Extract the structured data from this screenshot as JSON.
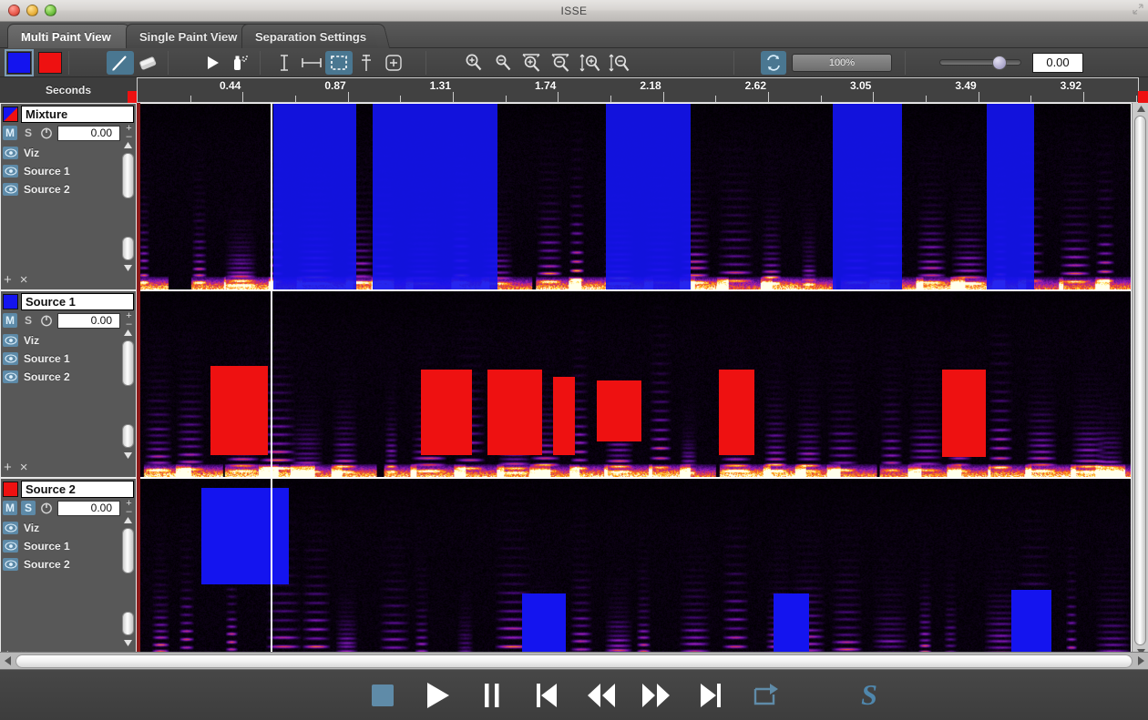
{
  "window": {
    "title": "ISSE",
    "controls": [
      "close",
      "minimize",
      "zoom"
    ]
  },
  "tabs": [
    {
      "label": "Multi Paint View",
      "active": true
    },
    {
      "label": "Single Paint View",
      "active": false
    },
    {
      "label": "Separation Settings",
      "active": false
    }
  ],
  "toolbar": {
    "swatches": [
      {
        "name": "paint-color-blue",
        "color": "#1414ef",
        "selected": true
      },
      {
        "name": "paint-color-red",
        "color": "#ee1111",
        "selected": false
      }
    ],
    "tools": [
      {
        "name": "brush-tool",
        "icon": "brush-icon",
        "active": true
      },
      {
        "name": "eraser-tool",
        "icon": "eraser-icon",
        "active": false
      },
      {
        "name": "pointer-tool",
        "icon": "pointer-icon",
        "active": false
      },
      {
        "name": "spray-tool",
        "icon": "spray-icon",
        "active": false
      },
      {
        "name": "time-select-tool",
        "icon": "i-beam-icon",
        "active": false
      },
      {
        "name": "time-range-tool",
        "icon": "horizontal-range-icon",
        "active": false
      },
      {
        "name": "box-select-tool",
        "icon": "marquee-icon",
        "active": true
      },
      {
        "name": "freq-range-tool",
        "icon": "vertical-range-icon",
        "active": false
      },
      {
        "name": "add-tool",
        "icon": "plus-circle-icon",
        "active": false
      }
    ],
    "zoom_tools": [
      {
        "name": "zoom-in-button",
        "icon": "magnifier-plus-icon"
      },
      {
        "name": "zoom-out-button",
        "icon": "magnifier-minus-icon"
      },
      {
        "name": "zoom-in-horizontal-button",
        "icon": "magnifier-horizontal-plus-icon"
      },
      {
        "name": "zoom-out-horizontal-button",
        "icon": "magnifier-horizontal-minus-icon"
      },
      {
        "name": "zoom-in-vertical-button",
        "icon": "magnifier-vertical-plus-icon"
      },
      {
        "name": "zoom-out-vertical-button",
        "icon": "magnifier-vertical-minus-icon"
      }
    ],
    "loop_button": {
      "name": "loop-toggle",
      "icon": "loop-icon",
      "active": true
    },
    "zoom_percent": "100%",
    "slider_value": "0.00",
    "slider_position_pct": 66
  },
  "ruler": {
    "unit_label": "Seconds",
    "ticks": [
      "0.44",
      "0.87",
      "1.31",
      "1.74",
      "2.18",
      "2.62",
      "3.05",
      "3.49",
      "3.92"
    ]
  },
  "tracks": [
    {
      "name": "Mixture",
      "color": "#1414ef",
      "swatch_kind": "split",
      "mute": "M",
      "solo": "S",
      "mute_on": true,
      "solo_on": false,
      "time_value": "0.00",
      "layers": [
        "Viz",
        "Source 1",
        "Source 2"
      ],
      "add_label": "+",
      "remove_label": "×"
    },
    {
      "name": "Source 1",
      "color": "#1414ef",
      "swatch_kind": "solid",
      "mute": "M",
      "solo": "S",
      "mute_on": true,
      "solo_on": false,
      "time_value": "0.00",
      "layers": [
        "Viz",
        "Source 1",
        "Source 2"
      ],
      "add_label": "+",
      "remove_label": "×"
    },
    {
      "name": "Source 2",
      "color": "#ee1111",
      "swatch_kind": "solid",
      "mute": "M",
      "solo": "S",
      "mute_on": true,
      "solo_on": true,
      "time_value": "0.00",
      "layers": [
        "Viz",
        "Source 1",
        "Source 2"
      ],
      "add_label": "+",
      "remove_label": "×"
    }
  ],
  "transport": [
    {
      "name": "stop-button",
      "icon": "stop-icon"
    },
    {
      "name": "play-button",
      "icon": "play-icon"
    },
    {
      "name": "pause-button",
      "icon": "pause-icon"
    },
    {
      "name": "go-to-start-button",
      "icon": "skip-back-icon"
    },
    {
      "name": "rewind-button",
      "icon": "rewind-icon"
    },
    {
      "name": "fast-forward-button",
      "icon": "fast-forward-icon"
    },
    {
      "name": "go-to-end-button",
      "icon": "skip-forward-icon"
    },
    {
      "name": "loop-playback-button",
      "icon": "loop-arrow-icon"
    }
  ],
  "logo": {
    "name": "isse-logo",
    "glyph": "S",
    "color": "#4f87ad"
  }
}
